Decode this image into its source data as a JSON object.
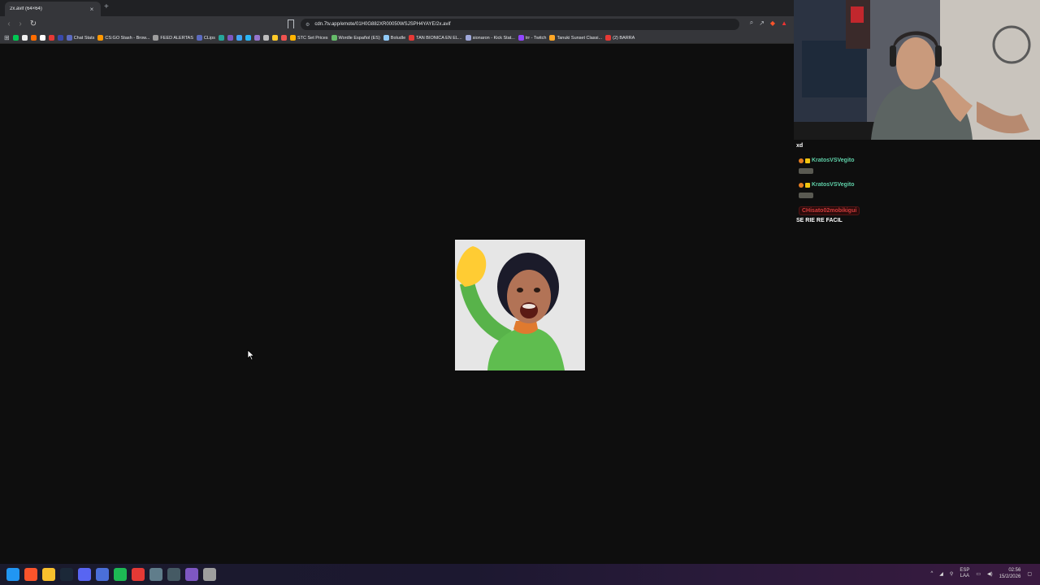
{
  "browser": {
    "tab": {
      "title": "2x.avif (64×64)",
      "close_glyph": "×"
    },
    "new_tab_glyph": "+",
    "address": "cdn.7tv.app/emote/01H0G882XR00050WSJSPH4YAYE/2x.avif",
    "bookmarks": [
      {
        "label": "",
        "color": "#00c853"
      },
      {
        "label": "",
        "color": "#eeeeee"
      },
      {
        "label": "",
        "color": "#ff6d00"
      },
      {
        "label": "",
        "color": "#ffffff"
      },
      {
        "label": "",
        "color": "#e53935"
      },
      {
        "label": "",
        "color": "#3949ab"
      },
      {
        "label": "Chat Stats",
        "color": "#5c6bc0"
      },
      {
        "label": "CS:GO Stash - Brow...",
        "color": "#ff9800"
      },
      {
        "label": "FEED ALERTAS",
        "color": "#9e9e9e"
      },
      {
        "label": "CLips",
        "color": "#5c6bc0"
      },
      {
        "label": "",
        "color": "#26a69a"
      },
      {
        "label": "",
        "color": "#7e57c2"
      },
      {
        "label": "",
        "color": "#42a5f5"
      },
      {
        "label": "",
        "color": "#29b6f6"
      },
      {
        "label": "",
        "color": "#9575cd"
      },
      {
        "label": "",
        "color": "#bdbdbd"
      },
      {
        "label": "",
        "color": "#ffca28"
      },
      {
        "label": "",
        "color": "#ef5350"
      },
      {
        "label": "STC Set Prices",
        "color": "#ffb300"
      },
      {
        "label": "Wordle Español (ES)",
        "color": "#66bb6a"
      },
      {
        "label": "Boludle",
        "color": "#90caf9"
      },
      {
        "label": "TAN BIONICA EN EL...",
        "color": "#e53935"
      },
      {
        "label": "sionaron - Kick Stat...",
        "color": "#9fa8da"
      },
      {
        "label": "trr - Twitch",
        "color": "#9146ff"
      },
      {
        "label": "Tanuki Sunset Classi...",
        "color": "#ffa726"
      },
      {
        "label": "(2) BARRA",
        "color": "#e53935"
      }
    ]
  },
  "stream": {
    "chat": [
      {
        "type": "text",
        "text": "xd"
      },
      {
        "type": "user",
        "name": "KratosVSVegito",
        "color": "#5fd0a8"
      },
      {
        "type": "user",
        "name": "KratosVSVegito",
        "color": "#5fd0a8"
      },
      {
        "type": "user",
        "name": "CHisato02mobikigui",
        "color": "#d13c3c"
      },
      {
        "type": "text",
        "text": "SE RIE RE FACIL"
      }
    ]
  },
  "taskbar": {
    "tray_language": [
      "ESP",
      "LAA"
    ],
    "time": "02:56",
    "date": "15/2/2026",
    "icons": [
      {
        "name": "windows",
        "color": "#2196f3"
      },
      {
        "name": "brave",
        "color": "#fb542b"
      },
      {
        "name": "explorer",
        "color": "#f9c02d"
      },
      {
        "name": "steam",
        "color": "#1b2838"
      },
      {
        "name": "discord",
        "color": "#5865f2"
      },
      {
        "name": "app-blue",
        "color": "#4a6fd8"
      },
      {
        "name": "spotify",
        "color": "#1db954"
      },
      {
        "name": "app-red",
        "color": "#e53935"
      },
      {
        "name": "app-gear",
        "color": "#607d8b"
      },
      {
        "name": "app-grid",
        "color": "#455a64"
      },
      {
        "name": "app-purple",
        "color": "#7e57c2"
      },
      {
        "name": "settings",
        "color": "#9e9e9e"
      }
    ]
  }
}
